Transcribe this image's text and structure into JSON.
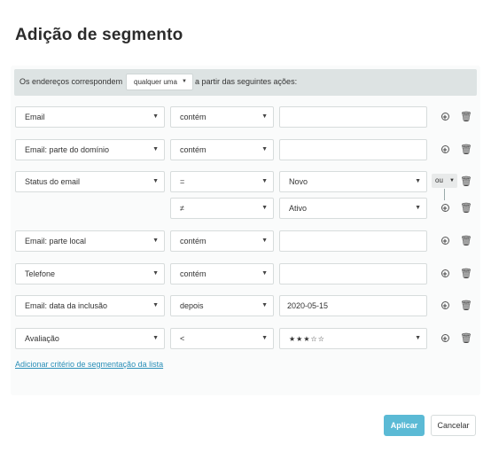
{
  "title": "Adição de segmento",
  "banner": {
    "prefix": "Os endereços correspondem",
    "match_value": "qualquer uma",
    "suffix": "a partir das seguintes ações:"
  },
  "rows": [
    {
      "field": "Email",
      "operator": "contém",
      "value": ""
    },
    {
      "field": "Email: parte do domínio",
      "operator": "contém",
      "value": ""
    },
    {
      "field": "Status do email",
      "operator": "=",
      "value": "Novo"
    },
    {
      "field": "",
      "operator": "≠",
      "value": "Ativo"
    },
    {
      "field": "Email: parte local",
      "operator": "contém",
      "value": ""
    },
    {
      "field": "Telefone",
      "operator": "contém",
      "value": ""
    },
    {
      "field": "Email: data da inclusão",
      "operator": "depois",
      "value": "2020-05-15"
    },
    {
      "field": "Avaliação",
      "operator": "<",
      "value": "★★★☆☆"
    }
  ],
  "ou_label": "ou",
  "add_link": "Adicionar critério de segmentação da lista",
  "buttons": {
    "apply": "Aplicar",
    "cancel": "Cancelar"
  },
  "icons": {
    "caret": "caret-down-icon",
    "add": "add-circle-icon",
    "delete": "trash-icon"
  }
}
